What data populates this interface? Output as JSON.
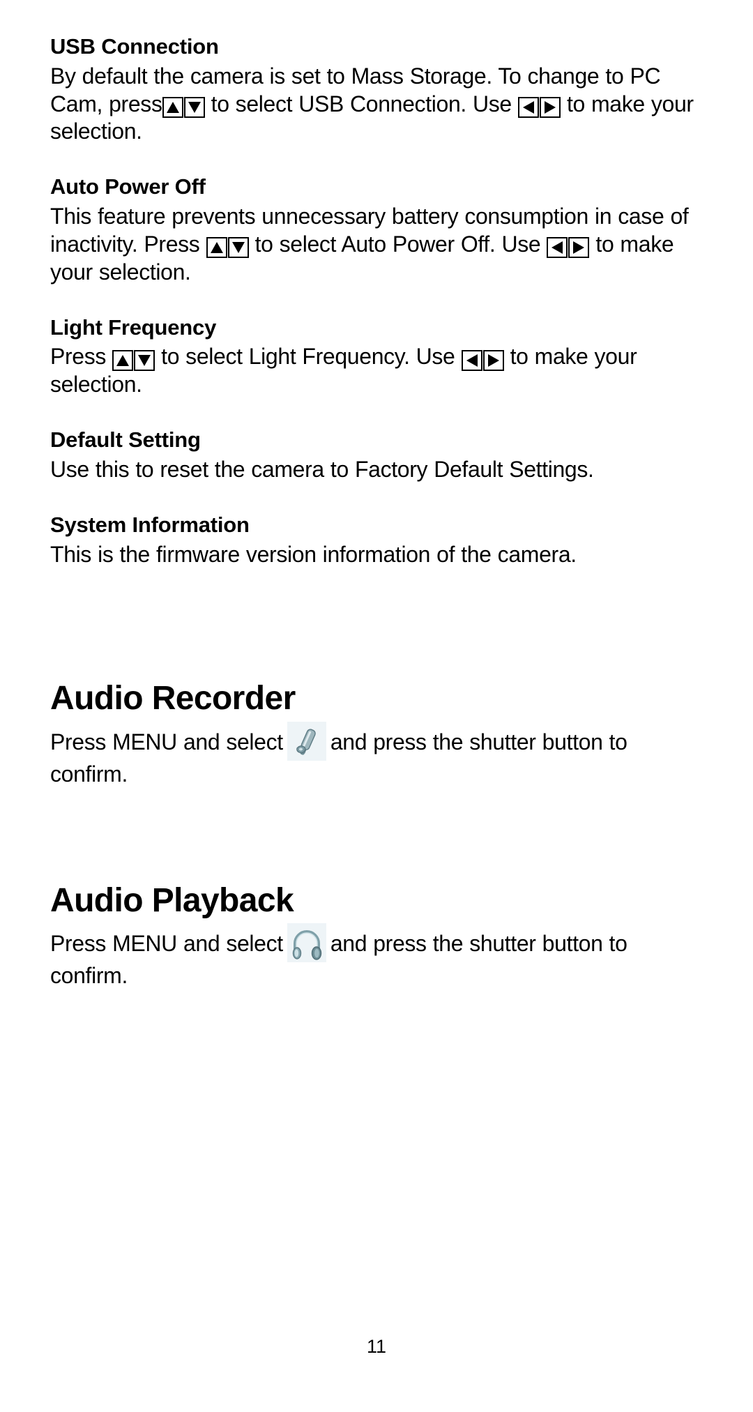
{
  "document": {
    "type": "camera-user-manual-page",
    "page_number": "11"
  },
  "sections": [
    {
      "id": "usb-connection",
      "heading": "USB Connection",
      "text_parts": {
        "p1": "By default the camera is set to Mass Storage. To change to PC Cam, press",
        "p2": "to select USB Connection.  Use",
        "p3": "to make your selection."
      },
      "icons": [
        "up-arrow-key-icon",
        "down-arrow-key-icon",
        "left-arrow-key-icon",
        "right-arrow-key-icon"
      ]
    },
    {
      "id": "auto-power-off",
      "heading": "Auto Power Off",
      "text_parts": {
        "p1": "This feature prevents unnecessary battery consumption in case of inactivity.  Press",
        "p2": "to select Auto Power Off.  Use",
        "p3": "to make your selection."
      },
      "icons": [
        "up-arrow-key-icon",
        "down-arrow-key-icon",
        "left-arrow-key-icon",
        "right-arrow-key-icon"
      ]
    },
    {
      "id": "light-frequency",
      "heading": "Light Frequency",
      "text_parts": {
        "p1": "Press",
        "p2": "to select Light Frequency.  Use",
        "p3": "to make your selection."
      },
      "icons": [
        "up-arrow-key-icon",
        "down-arrow-key-icon",
        "left-arrow-key-icon",
        "right-arrow-key-icon"
      ]
    },
    {
      "id": "default-setting",
      "heading": "Default Setting",
      "text_parts": {
        "p1": "Use this to reset the camera to Factory Default Settings."
      }
    },
    {
      "id": "system-information",
      "heading": "System Information",
      "text_parts": {
        "p1": "This is the firmware version information of the camera."
      }
    }
  ],
  "major_sections": [
    {
      "id": "audio-recorder",
      "heading": "Audio Recorder",
      "text_parts": {
        "p1": "Press MENU and select",
        "p2": "and press the shutter button to confirm."
      },
      "icon": "audio-recorder-icon"
    },
    {
      "id": "audio-playback",
      "heading": "Audio Playback",
      "text_parts": {
        "p1": "Press MENU and select",
        "p2": "and press the shutter button to confirm."
      },
      "icon": "headphones-icon"
    }
  ],
  "colors": {
    "text": "#000000",
    "background": "#ffffff",
    "icon_background": "#eef4f7",
    "icon_body": "#6d8d95",
    "icon_highlight": "#b8ccd3"
  }
}
